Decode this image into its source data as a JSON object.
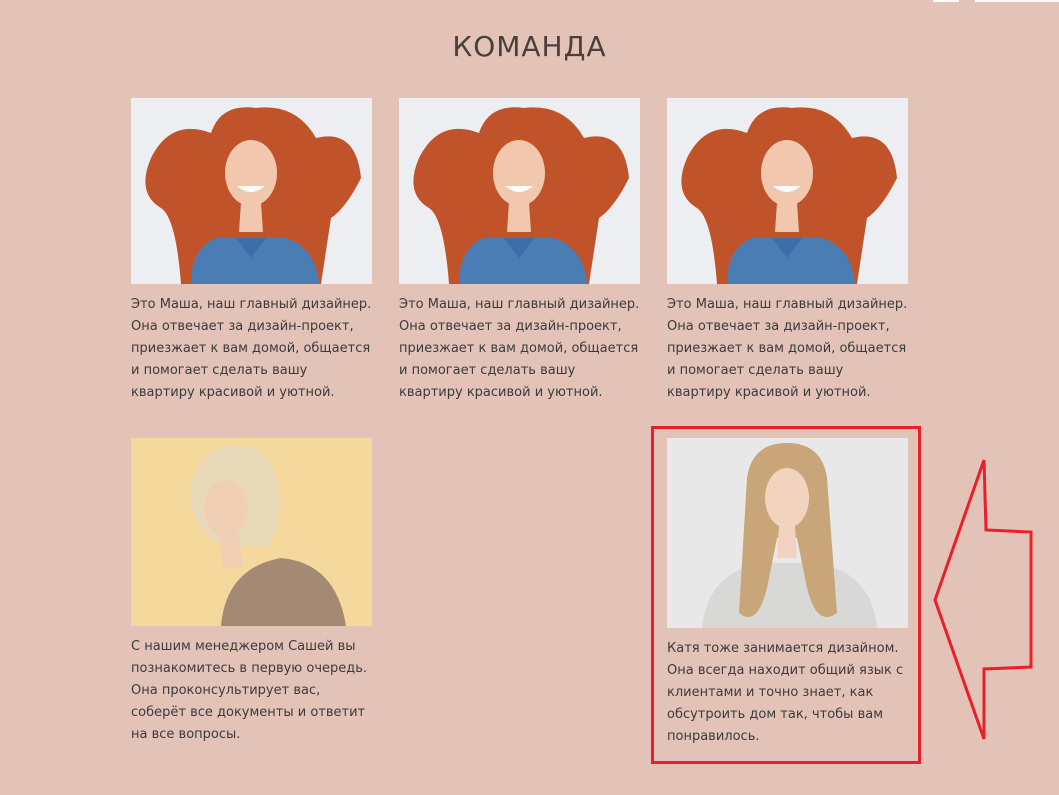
{
  "section": {
    "title": "КОМАНДА"
  },
  "members": [
    {
      "photo_icon": "red-curly-haired-woman-photo",
      "description": "Это Маша, наш главный дизайнер. Она отвечает за дизайн-проект, приезжает к вам домой, общается и помогает сделать вашу квартиру красивой и уютной."
    },
    {
      "photo_icon": "red-curly-haired-woman-photo",
      "description": "Это Маша, наш главный дизайнер. Она отвечает за дизайн-проект, приезжает к вам домой, общается и помогает сделать вашу квартиру красивой и уютной."
    },
    {
      "photo_icon": "red-curly-haired-woman-photo",
      "description": "Это Маша, наш главный дизайнер. Она отвечает за дизайн-проект, приезжает к вам домой, общается и помогает сделать вашу квартиру красивой и уютной."
    },
    {
      "photo_icon": "blonde-woman-yellow-background-photo",
      "description": "С нашим менеджером Сашей вы познакомитесь в первую очередь. Она проконсультирует вас, соберёт все документы и ответит на все вопросы."
    },
    {
      "photo_icon": "long-haired-blonde-woman-photo",
      "description": "Катя тоже занимается дизайном. Она всегда находит общий язык с клиентами и точно знает, как обсутроить дом так, чтобы вам понравилось."
    }
  ],
  "annotation": {
    "color": "#e8202a",
    "icon": "left-arrow-icon"
  },
  "colors": {
    "background": "#e3c3b8",
    "text": "#3b3b3b"
  }
}
